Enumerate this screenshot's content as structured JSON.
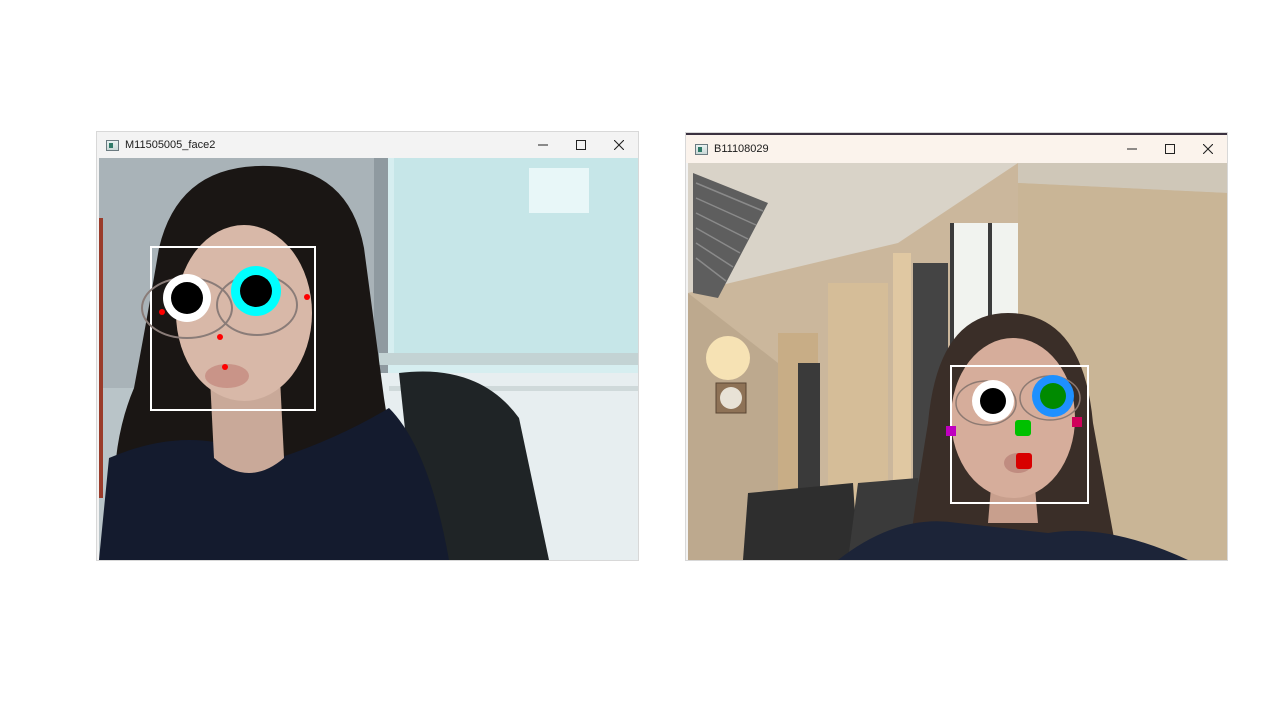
{
  "windows": [
    {
      "title": "M11505005_face2",
      "controls": {
        "minimize": "minimize",
        "maximize": "maximize",
        "close": "close"
      }
    },
    {
      "title": "B11108029",
      "controls": {
        "minimize": "minimize",
        "maximize": "maximize",
        "close": "close"
      }
    }
  ],
  "colors": {
    "face_box": "#ffffff",
    "left_eye_ring": "#ffffff",
    "right_eye_ring_win1": "#00ffff",
    "right_eye_ring_win2": "#1e90ff",
    "pupil": "#000000",
    "right_pupil_win2": "#008a00",
    "landmark_dot_win1": "#ff0000",
    "nose_marker_win2": "#00c000",
    "mouth_marker_win2": "#d80000",
    "cheek_marker_left_win2": "#c000c0",
    "cheek_marker_right_win2": "#d0005a"
  }
}
